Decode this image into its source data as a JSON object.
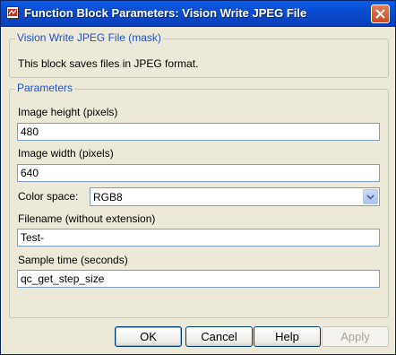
{
  "window": {
    "title": "Function Block Parameters: Vision Write JPEG File"
  },
  "description_group": {
    "legend": "Vision Write JPEG File (mask)",
    "text": "This block saves files in JPEG format."
  },
  "parameters_group": {
    "legend": "Parameters",
    "image_height": {
      "label": "Image height (pixels)",
      "value": "480"
    },
    "image_width": {
      "label": "Image width (pixels)",
      "value": "640"
    },
    "color_space": {
      "label": "Color space:",
      "value": "RGB8"
    },
    "filename": {
      "label": "Filename (without extension)",
      "value": "Test-"
    },
    "sample_time": {
      "label": "Sample time (seconds)",
      "value": "qc_get_step_size"
    }
  },
  "buttons": {
    "ok": "OK",
    "cancel": "Cancel",
    "help": "Help",
    "apply": "Apply"
  },
  "icons": {
    "window_icon": "simulink-block-icon",
    "close": "close-icon",
    "dropdown": "chevron-down-icon"
  },
  "colors": {
    "titlebar": "#0a4cd0",
    "legend_text": "#2050c8",
    "dialog_bg": "#ece9d8"
  }
}
